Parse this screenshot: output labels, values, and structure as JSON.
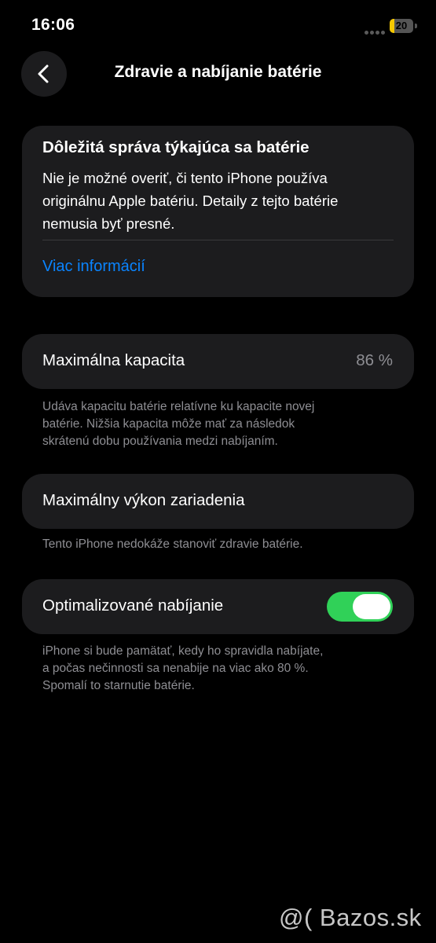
{
  "status_bar": {
    "time": "16:06",
    "battery_level": "20",
    "battery_fraction": 0.2,
    "battery_color": "#f5c800"
  },
  "nav": {
    "title": "Zdravie a nabíjanie batérie",
    "back_icon": "chevron-left-icon"
  },
  "alert": {
    "title": "Dôležitá správa týkajúca sa batérie",
    "body": "Nie je možné overiť, či tento iPhone používa\noriginálnu Apple batériu. Detaily z tejto batérie\nnemusia byť presné.",
    "link": "Viac informácií"
  },
  "capacity": {
    "label": "Maximálna kapacita",
    "value": "86 %",
    "footnote": "Udáva kapacitu batérie relatívne ku kapacite novej\nbatérie. Nižšia kapacita môže mať za následok\nskrátenú dobu používania medzi nabíjaním."
  },
  "performance": {
    "label": "Maximálny výkon zariadenia",
    "footnote": "Tento iPhone nedokáže stanoviť zdravie batérie."
  },
  "optimized": {
    "label": "Optimalizované nabíjanie",
    "enabled": true,
    "footnote": "iPhone si bude pamätať, kedy ho spravidla nabíjate,\na počas nečinnosti sa nenabije na viac ako 80 %.\nSpomalí to starnutie batérie."
  },
  "colors": {
    "accent": "#0a84ff",
    "toggle_on": "#30d158"
  },
  "watermark": "@( Bazos.sk"
}
